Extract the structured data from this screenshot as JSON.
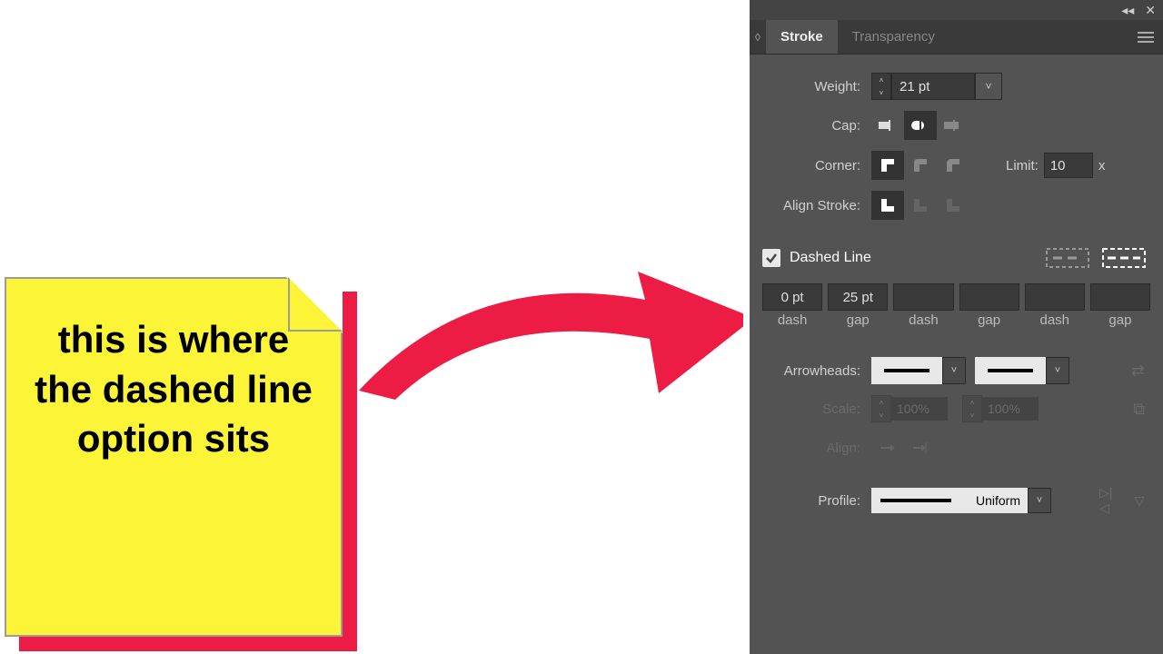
{
  "note": {
    "text": "this is where the dashed line option sits"
  },
  "panel": {
    "tabs": {
      "stroke": "Stroke",
      "transparency": "Transparency"
    },
    "weight": {
      "label": "Weight:",
      "value": "21 pt"
    },
    "cap": {
      "label": "Cap:"
    },
    "corner": {
      "label": "Corner:"
    },
    "limit": {
      "label": "Limit:",
      "value": "10",
      "suffix": "x"
    },
    "alignStroke": {
      "label": "Align Stroke:"
    },
    "dashed": {
      "label": "Dashed Line"
    },
    "dashInputs": [
      "0 pt",
      "25 pt",
      "",
      "",
      "",
      ""
    ],
    "dashLabels": [
      "dash",
      "gap",
      "dash",
      "gap",
      "dash",
      "gap"
    ],
    "arrowheads": {
      "label": "Arrowheads:"
    },
    "scale": {
      "label": "Scale:",
      "val1": "100%",
      "val2": "100%"
    },
    "align": {
      "label": "Align:"
    },
    "profile": {
      "label": "Profile:",
      "value": "Uniform"
    }
  }
}
